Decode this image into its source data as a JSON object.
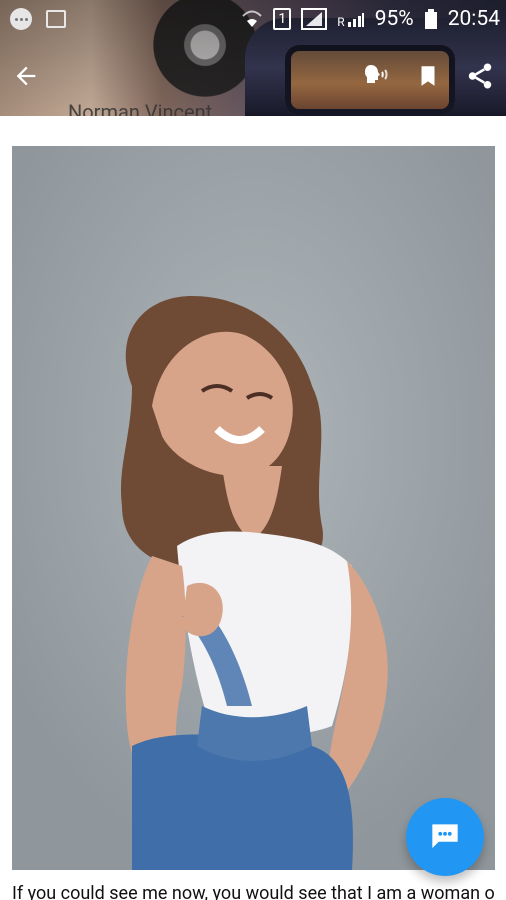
{
  "status_bar": {
    "battery_percent": "95%",
    "time": "20:54",
    "sim_badge": "1",
    "roaming": "R"
  },
  "header": {
    "subtext": "Norman Vincent"
  },
  "article": {
    "next_line": "If you could see me now, you would see that I am a woman of"
  },
  "icons": {
    "back": "arrow-left-icon",
    "listen": "speaker-icon",
    "bookmark": "bookmark-icon",
    "share": "share-icon",
    "fab": "chat-bubble-icon"
  },
  "colors": {
    "fab": "#2196f3"
  }
}
